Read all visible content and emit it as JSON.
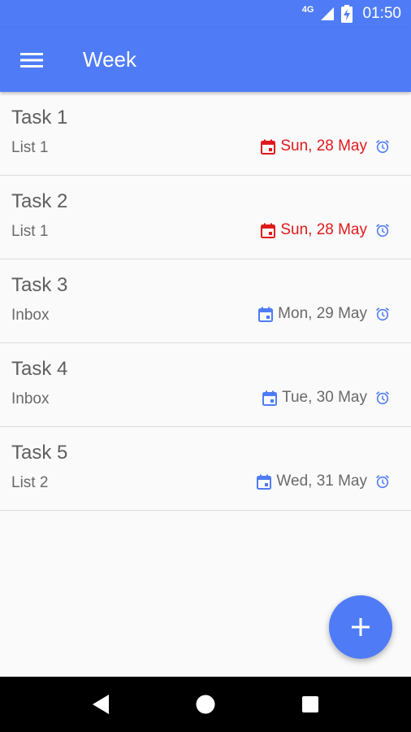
{
  "status": {
    "network": "4G",
    "time": "01:50"
  },
  "app_bar": {
    "title": "Week"
  },
  "tasks": [
    {
      "title": "Task 1",
      "list": "List 1",
      "date": "Sun, 28 May",
      "overdue": true
    },
    {
      "title": "Task 2",
      "list": "List 1",
      "date": "Sun, 28 May",
      "overdue": true
    },
    {
      "title": "Task 3",
      "list": "Inbox",
      "date": "Mon, 29 May",
      "overdue": false
    },
    {
      "title": "Task 4",
      "list": "Inbox",
      "date": "Tue, 30 May",
      "overdue": false
    },
    {
      "title": "Task 5",
      "list": "List 2",
      "date": "Wed, 31 May",
      "overdue": false
    }
  ],
  "icons": {
    "menu": "menu-icon",
    "calendar": "calendar-icon",
    "alarm": "alarm-icon",
    "add": "plus-icon",
    "back": "back-icon",
    "home": "home-icon",
    "recents": "recents-icon"
  },
  "colors": {
    "primary": "#4f7cf6",
    "overdue": "#e0191c",
    "text_secondary": "#6a6a6a"
  }
}
